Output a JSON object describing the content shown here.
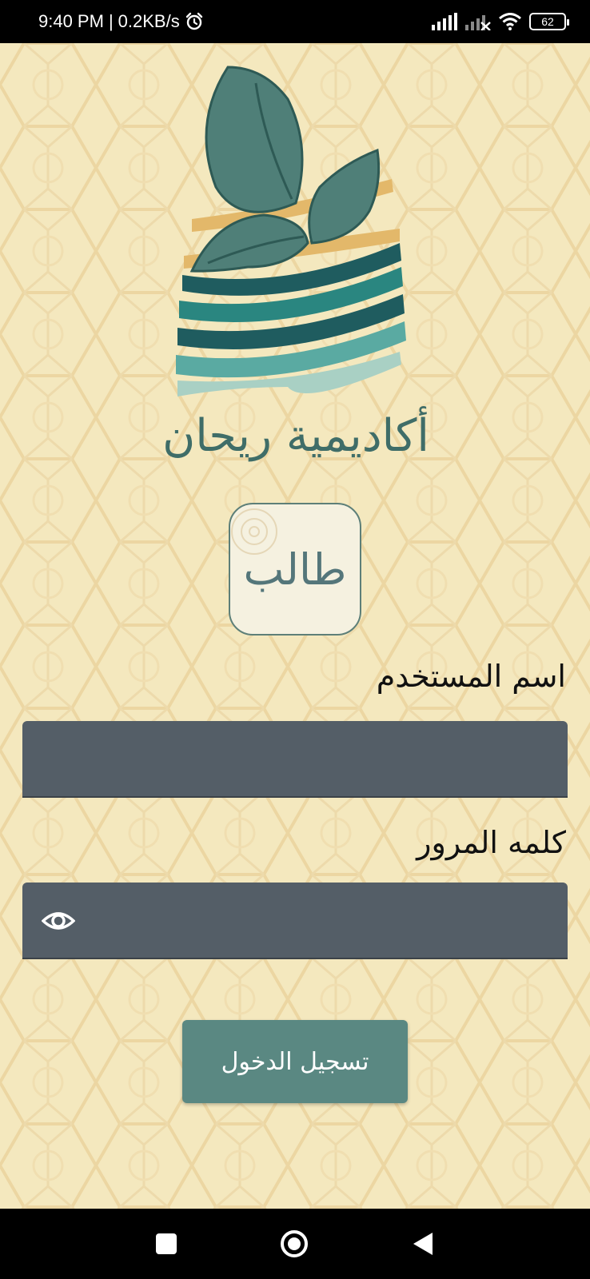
{
  "status_bar": {
    "time": "9:40 PM",
    "separator": "|",
    "network_speed": "0.2KB/s",
    "alarm_icon": "alarm-icon",
    "signal_icon": "signal-icon",
    "signal2_icon": "signal-no-service-icon",
    "wifi_icon": "wifi-icon",
    "battery": "62"
  },
  "logo": {
    "brand_name": "أكاديمية ريحان",
    "colors": {
      "leaf": "#4f7f78",
      "teal": "#2f8f8a",
      "gold": "#e3b86a"
    }
  },
  "role": {
    "label": "طالب"
  },
  "form": {
    "username_label": "اسم المستخدم",
    "username_value": "",
    "password_label": "كلمه المرور",
    "password_value": "",
    "password_toggle_icon": "eye-icon"
  },
  "login_button": {
    "label": "تسجيل الدخول"
  },
  "nav_bar": {
    "recents_icon": "square-icon",
    "home_icon": "circle-icon",
    "back_icon": "back-triangle-icon"
  },
  "colors": {
    "background": "#f4e8be",
    "input_fill": "#545e67",
    "button": "#5a8882",
    "text": "#111111"
  }
}
